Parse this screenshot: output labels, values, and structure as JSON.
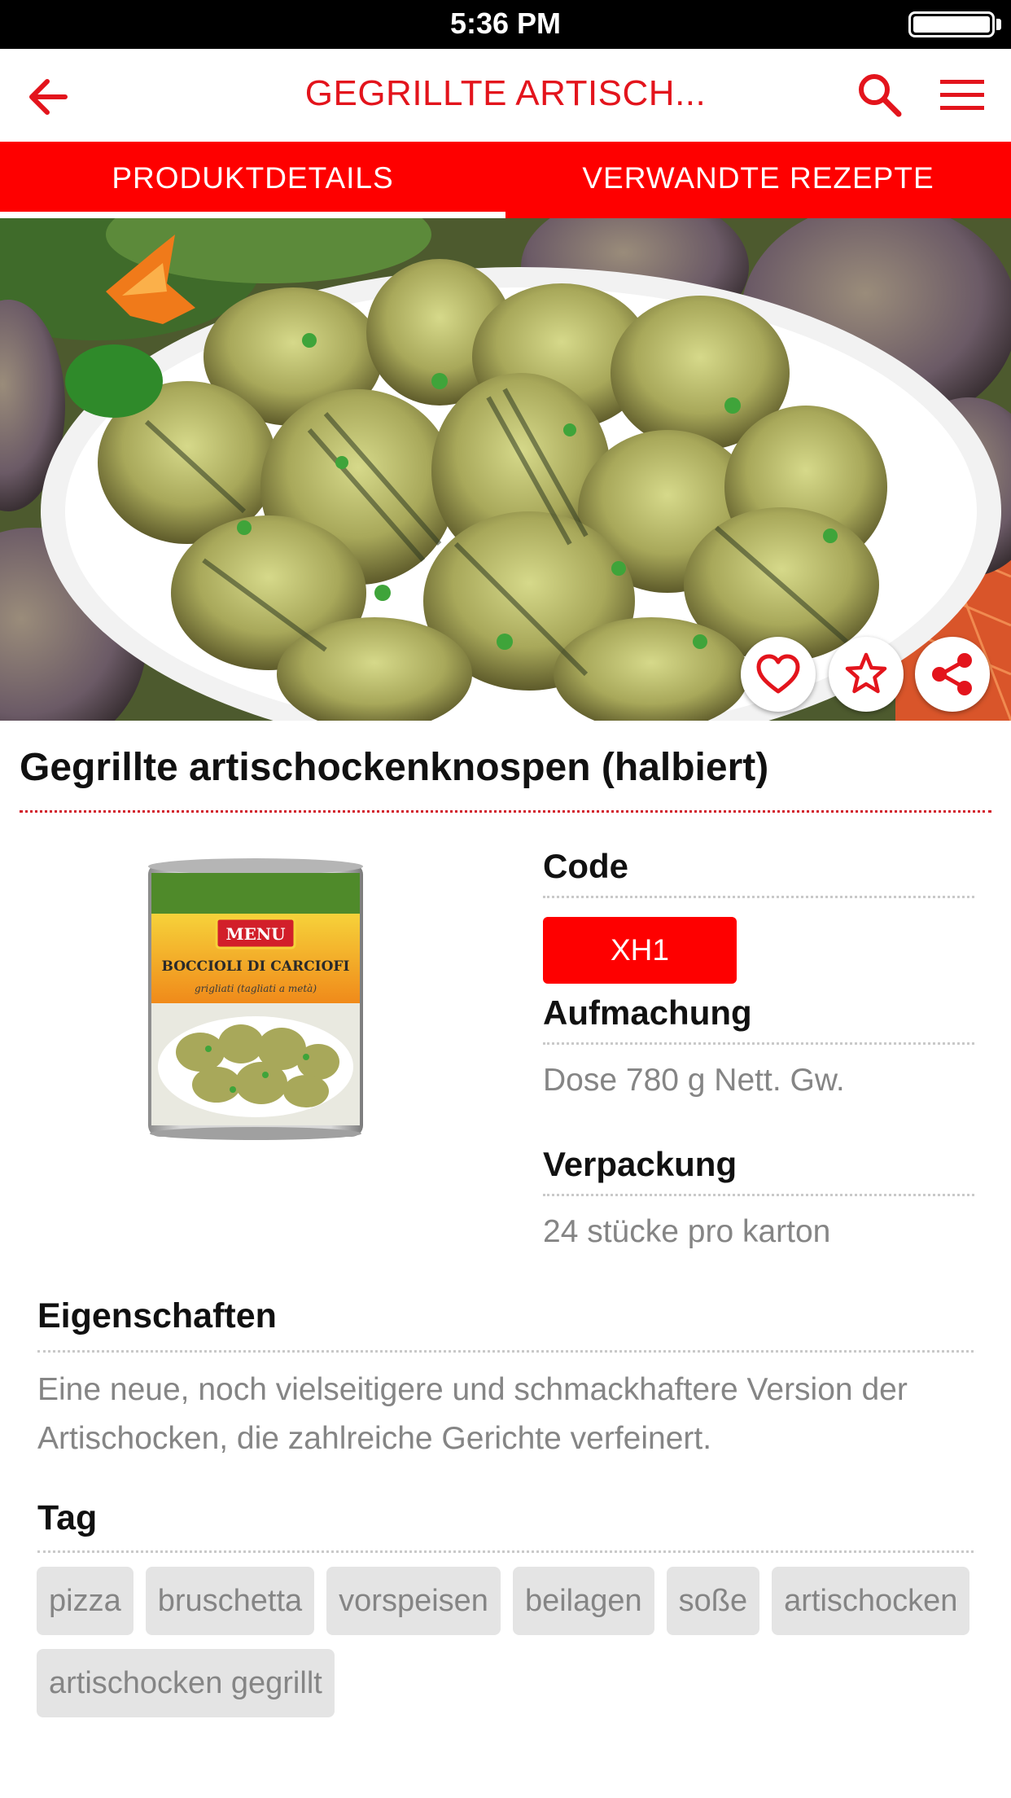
{
  "status_bar": {
    "time": "5:36 PM"
  },
  "nav": {
    "title": "GEGRILLTE ARTISCH...",
    "back_icon": "arrow-left-icon",
    "search_icon": "search-icon",
    "menu_icon": "hamburger-menu-icon"
  },
  "tabs": [
    {
      "label": "PRODUKTDETAILS",
      "active": true
    },
    {
      "label": "VERWANDTE REZEPTE",
      "active": false
    }
  ],
  "actions": {
    "favorite_icon": "heart-icon",
    "star_icon": "star-icon",
    "share_icon": "share-icon"
  },
  "product": {
    "title": "Gegrillte artischockenknospen (halbiert)",
    "can_brand": "MENU",
    "can_name": "BOCCIOLI DI CARCIOFI",
    "can_subtitle": "grigliati (tagliati a metà)"
  },
  "details": {
    "code_label": "Code",
    "code_value": "XH1",
    "packaging_label": "Aufmachung",
    "packaging_value": "Dose 780 g Nett. Gw.",
    "package_label": "Verpackung",
    "package_value": "24 stücke pro karton"
  },
  "properties": {
    "label": "Eigenschaften",
    "text": "Eine neue, noch vielseitigere und schmackhaftere Version der Artischocken, die zahlreiche Gerichte verfeinert."
  },
  "tags": {
    "label": "Tag",
    "items": [
      "pizza",
      "bruschetta",
      "vorspeisen",
      "beilagen",
      "soße",
      "artischocken",
      "artischocken gegrillt"
    ]
  },
  "colors": {
    "brand_red": "#fe0000",
    "title_red": "#e3141c",
    "muted_text": "#858585",
    "tag_bg": "#e4e4e4"
  }
}
